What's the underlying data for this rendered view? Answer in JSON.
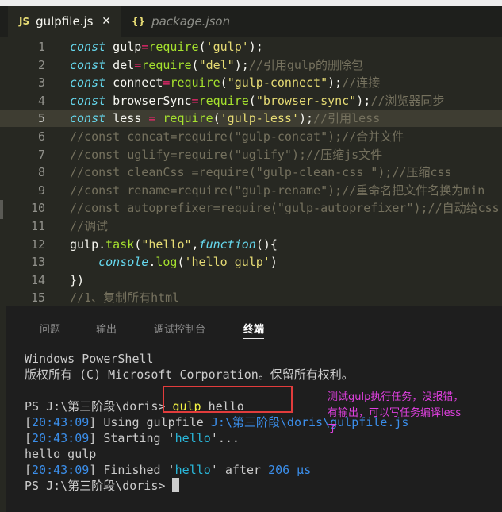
{
  "tabs": [
    {
      "icon": "JS",
      "label": "gulpfile.js",
      "close": "✕"
    },
    {
      "icon": "{}",
      "label": "package.json"
    }
  ],
  "editor": {
    "lines": [
      {
        "num": "1",
        "tokens": [
          {
            "t": "const",
            "c": "k"
          },
          {
            "t": " gulp"
          },
          {
            "t": "=",
            "c": "o"
          },
          {
            "t": "require",
            "c": "f"
          },
          {
            "t": "("
          },
          {
            "t": "'gulp'",
            "c": "s"
          },
          {
            "t": ");"
          }
        ]
      },
      {
        "num": "2",
        "tokens": [
          {
            "t": "const",
            "c": "k"
          },
          {
            "t": " del"
          },
          {
            "t": "=",
            "c": "o"
          },
          {
            "t": "require",
            "c": "f"
          },
          {
            "t": "("
          },
          {
            "t": "\"del\"",
            "c": "s"
          },
          {
            "t": ");"
          },
          {
            "t": "//引用gulp的删除包",
            "c": "c"
          }
        ]
      },
      {
        "num": "3",
        "tokens": [
          {
            "t": "const",
            "c": "k"
          },
          {
            "t": " connect"
          },
          {
            "t": "=",
            "c": "o"
          },
          {
            "t": "require",
            "c": "f"
          },
          {
            "t": "("
          },
          {
            "t": "\"gulp-connect\"",
            "c": "s"
          },
          {
            "t": ");"
          },
          {
            "t": "//连接",
            "c": "c"
          }
        ]
      },
      {
        "num": "4",
        "tokens": [
          {
            "t": "const",
            "c": "k"
          },
          {
            "t": " browserSync"
          },
          {
            "t": "=",
            "c": "o"
          },
          {
            "t": "require",
            "c": "f"
          },
          {
            "t": "("
          },
          {
            "t": "\"browser-sync\"",
            "c": "s"
          },
          {
            "t": ");"
          },
          {
            "t": "//浏览器同步",
            "c": "c"
          }
        ]
      },
      {
        "num": "5",
        "hl": true,
        "tokens": [
          {
            "t": "const",
            "c": "k"
          },
          {
            "t": " less "
          },
          {
            "t": "=",
            "c": "o"
          },
          {
            "t": " "
          },
          {
            "t": "require",
            "c": "f"
          },
          {
            "t": "("
          },
          {
            "t": "'gulp-less'",
            "c": "s"
          },
          {
            "t": ");"
          },
          {
            "t": "//引用less",
            "c": "c"
          }
        ]
      },
      {
        "num": "6",
        "tokens": [
          {
            "t": "//const concat=require(\"gulp-concat\");//合并文件",
            "c": "c"
          }
        ]
      },
      {
        "num": "7",
        "tokens": [
          {
            "t": "//const uglify=require(\"uglify\");//压缩js文件",
            "c": "c"
          }
        ]
      },
      {
        "num": "8",
        "tokens": [
          {
            "t": "//const cleanCss =require(\"gulp-clean-css \");//压缩css",
            "c": "c"
          }
        ]
      },
      {
        "num": "9",
        "tokens": [
          {
            "t": "//const rename=require(\"gulp-rename\");//重命名把文件名换为min",
            "c": "c"
          }
        ]
      },
      {
        "num": "10",
        "tokens": [
          {
            "t": "//const autoprefixer=require(\"gulp-autoprefixer\");//自动给css",
            "c": "c"
          }
        ]
      },
      {
        "num": "11",
        "tokens": [
          {
            "t": "//调试",
            "c": "c"
          }
        ]
      },
      {
        "num": "12",
        "tokens": [
          {
            "t": "gulp."
          },
          {
            "t": "task",
            "c": "f"
          },
          {
            "t": "("
          },
          {
            "t": "\"hello\"",
            "c": "s"
          },
          {
            "t": ","
          },
          {
            "t": "function",
            "c": "k"
          },
          {
            "t": "(){"
          }
        ]
      },
      {
        "num": "13",
        "tokens": [
          {
            "t": "    "
          },
          {
            "t": "console",
            "c": "k"
          },
          {
            "t": "."
          },
          {
            "t": "log",
            "c": "f"
          },
          {
            "t": "("
          },
          {
            "t": "'hello gulp'",
            "c": "s"
          },
          {
            "t": ")"
          }
        ]
      },
      {
        "num": "14",
        "tokens": [
          {
            "t": "})"
          }
        ]
      },
      {
        "num": "15",
        "tokens": [
          {
            "t": "//1、复制所有html",
            "c": "c"
          }
        ]
      }
    ]
  },
  "panel": {
    "tabs": [
      "问题",
      "输出",
      "调试控制台",
      "终端"
    ],
    "active_tab": "终端"
  },
  "terminal": {
    "lines": [
      [
        {
          "t": "Windows PowerShell"
        }
      ],
      [
        {
          "t": "版权所有 (C) Microsoft Corporation。保留所有权利。"
        }
      ],
      [
        {
          "t": " "
        }
      ],
      [
        {
          "t": "PS J:\\第三阶段\\doris> "
        },
        {
          "t": "gulp",
          "c": "tyellow"
        },
        {
          "t": " hello"
        }
      ],
      [
        {
          "t": "["
        },
        {
          "t": "20:43:09",
          "c": "tblue"
        },
        {
          "t": "] Using gulpfile "
        },
        {
          "t": "J:\\第三阶段\\doris\\gulpfile.js",
          "c": "tblue"
        }
      ],
      [
        {
          "t": "["
        },
        {
          "t": "20:43:09",
          "c": "tblue"
        },
        {
          "t": "] Starting '"
        },
        {
          "t": "hello",
          "c": "tcyan"
        },
        {
          "t": "'..."
        }
      ],
      [
        {
          "t": "hello gulp"
        }
      ],
      [
        {
          "t": "["
        },
        {
          "t": "20:43:09",
          "c": "tblue"
        },
        {
          "t": "] Finished '"
        },
        {
          "t": "hello",
          "c": "tcyan"
        },
        {
          "t": "' after "
        },
        {
          "t": "206 μs",
          "c": "tblue"
        }
      ],
      [
        {
          "t": "PS J:\\第三阶段\\doris> "
        }
      ]
    ]
  },
  "annotation": {
    "text": "测试gulp执行任务，没报错，\n有输出，可以写任务编译less\n了"
  },
  "colors": {
    "editor_bg": "#272822",
    "panel_bg": "#1e1e1e",
    "annotation": "#e040e0",
    "highlight_box": "#e23c3c"
  }
}
